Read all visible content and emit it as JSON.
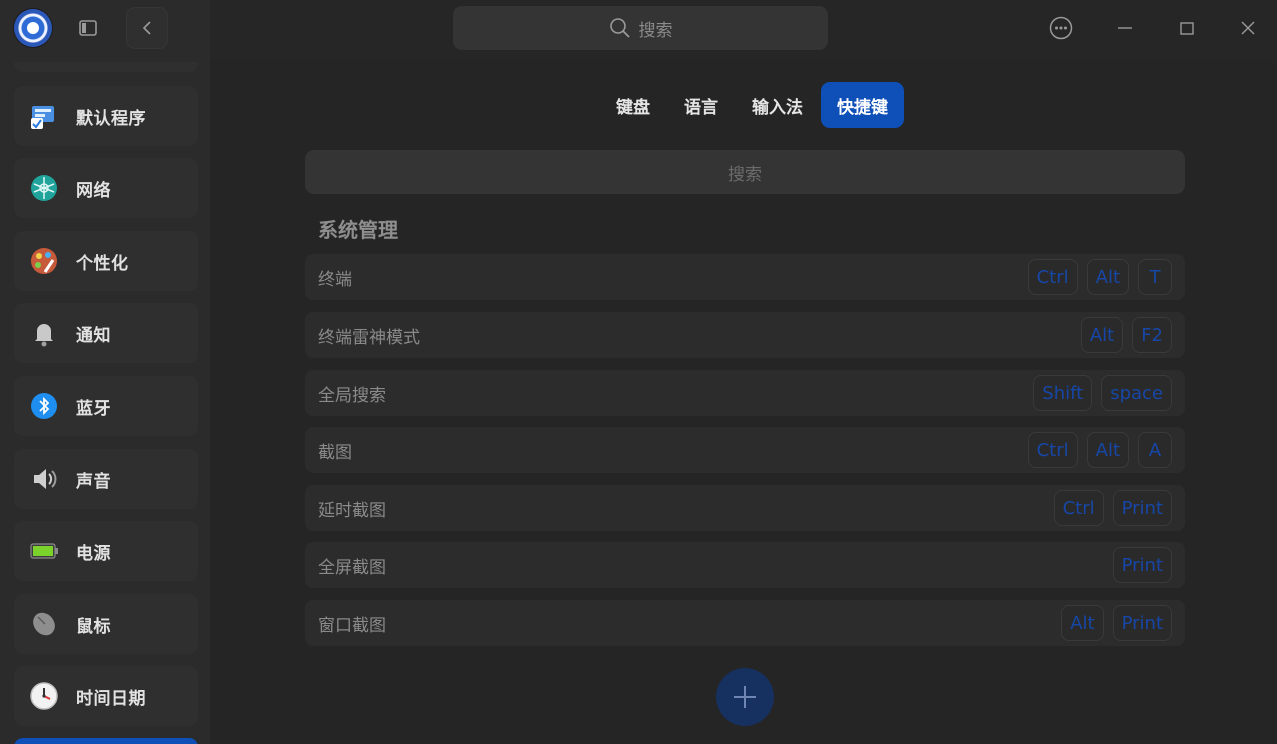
{
  "window": {
    "search_placeholder": "搜索"
  },
  "sidebar": {
    "items": [
      {
        "label": "默认程序",
        "icon": "default-apps-icon"
      },
      {
        "label": "网络",
        "icon": "network-icon"
      },
      {
        "label": "个性化",
        "icon": "personalization-icon"
      },
      {
        "label": "通知",
        "icon": "bell-icon"
      },
      {
        "label": "蓝牙",
        "icon": "bluetooth-icon"
      },
      {
        "label": "声音",
        "icon": "speaker-icon"
      },
      {
        "label": "电源",
        "icon": "battery-icon"
      },
      {
        "label": "鼠标",
        "icon": "mouse-icon"
      },
      {
        "label": "时间日期",
        "icon": "clock-icon"
      }
    ]
  },
  "tabs": [
    {
      "label": "键盘",
      "active": false
    },
    {
      "label": "语言",
      "active": false
    },
    {
      "label": "输入法",
      "active": false
    },
    {
      "label": "快捷键",
      "active": true
    }
  ],
  "shortcuts": {
    "search_placeholder": "搜索",
    "section_title": "系统管理",
    "rows": [
      {
        "name": "终端",
        "keys": [
          "Ctrl",
          "Alt",
          "T"
        ]
      },
      {
        "name": "终端雷神模式",
        "keys": [
          "Alt",
          "F2"
        ]
      },
      {
        "name": "全局搜索",
        "keys": [
          "Shift",
          "space"
        ]
      },
      {
        "name": "截图",
        "keys": [
          "Ctrl",
          "Alt",
          "A"
        ]
      },
      {
        "name": "延时截图",
        "keys": [
          "Ctrl",
          "Print"
        ]
      },
      {
        "name": "全屏截图",
        "keys": [
          "Print"
        ]
      },
      {
        "name": "窗口截图",
        "keys": [
          "Alt",
          "Print"
        ]
      }
    ]
  },
  "colors": {
    "accent": "#0f4fb8",
    "key_text": "#1747a6"
  }
}
